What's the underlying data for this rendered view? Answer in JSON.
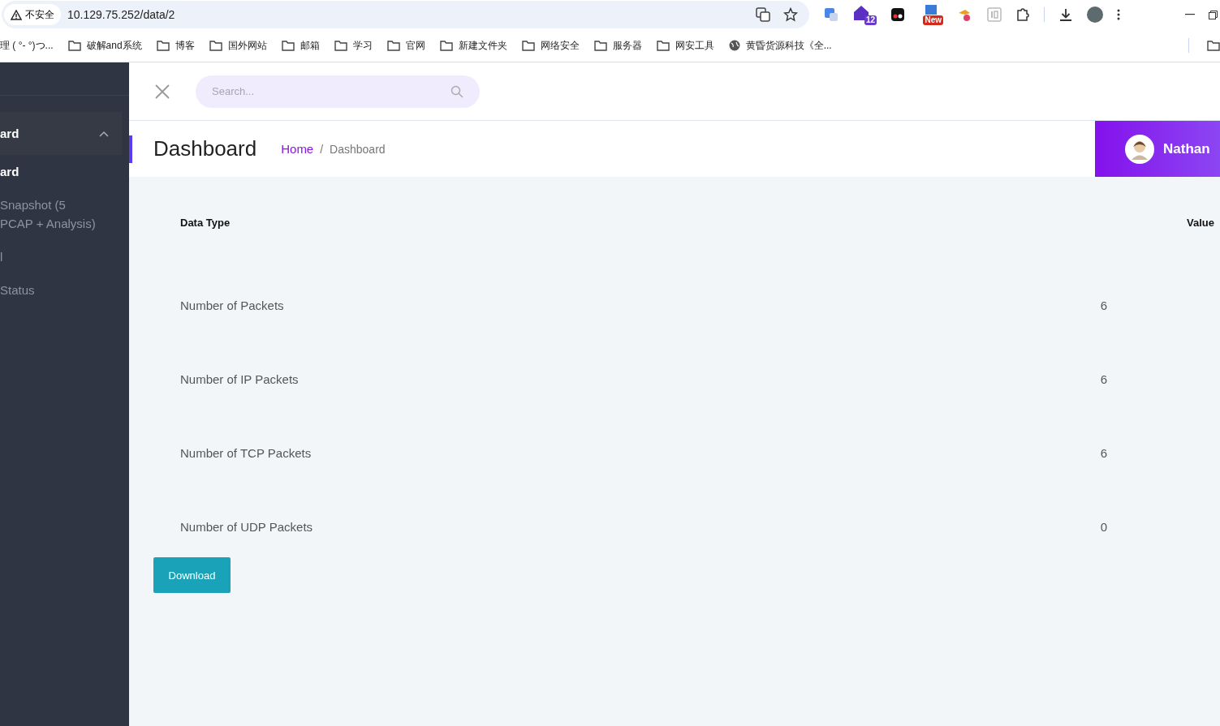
{
  "browser": {
    "security_label": "不安全",
    "url": "10.129.75.252/data/2",
    "bookmarks": [
      {
        "label": "理 ( °- °)つ...",
        "kind": "text"
      },
      {
        "label": "破解and系统",
        "kind": "folder"
      },
      {
        "label": "博客",
        "kind": "folder"
      },
      {
        "label": "国外网站",
        "kind": "folder"
      },
      {
        "label": "邮箱",
        "kind": "folder"
      },
      {
        "label": "学习",
        "kind": "folder"
      },
      {
        "label": "官网",
        "kind": "folder"
      },
      {
        "label": "新建文件夹",
        "kind": "folder"
      },
      {
        "label": "网络安全",
        "kind": "folder"
      },
      {
        "label": "服务器",
        "kind": "folder"
      },
      {
        "label": "网安工具",
        "kind": "folder"
      },
      {
        "label": "黄昏货源科技《全...",
        "kind": "site"
      }
    ],
    "extension_badges": [
      "12",
      "New"
    ]
  },
  "sidebar": {
    "items": [
      {
        "label": "ard",
        "kind": "group",
        "expanded": true
      },
      {
        "label": "ard",
        "kind": "item",
        "selected": true
      },
      {
        "label": "Snapshot (5\nPCAP + Analysis)",
        "kind": "item",
        "selected": false
      },
      {
        "label": "l",
        "kind": "item",
        "selected": false
      },
      {
        "label": "Status",
        "kind": "item",
        "selected": false
      }
    ]
  },
  "search": {
    "placeholder": "Search..."
  },
  "page": {
    "title": "Dashboard",
    "breadcrumb": [
      "Home",
      "Dashboard"
    ],
    "breadcrumb_separator": "/",
    "user": "Nathan"
  },
  "table": {
    "columns": [
      "Data Type",
      "Value"
    ],
    "rows": [
      [
        "Number of Packets",
        "6"
      ],
      [
        "Number of IP Packets",
        "6"
      ],
      [
        "Number of TCP Packets",
        "6"
      ],
      [
        "Number of UDP Packets",
        "0"
      ]
    ]
  },
  "download_button": "Download"
}
